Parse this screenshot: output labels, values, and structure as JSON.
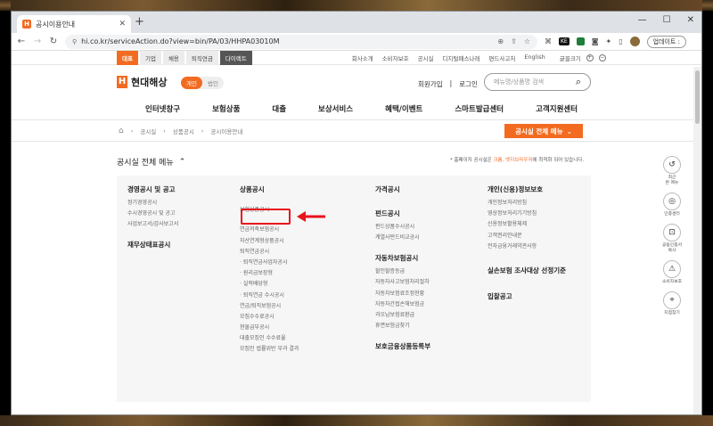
{
  "browser": {
    "tab_title": "공시이용안내",
    "tab_favicon": "H",
    "new_tab": "+",
    "url": "hi.co.kr/serviceAction.do?view=bin/PA/03/HHPA03010M",
    "update_button": "업데이트 :",
    "window_controls": [
      "—",
      "☐",
      "✕"
    ],
    "ext_badge": "KE"
  },
  "utility": {
    "tabs": [
      "대표",
      "기업",
      "채용",
      "퇴직연금",
      "다이렉트"
    ],
    "links": [
      "회사소개",
      "소비자보호",
      "공시실",
      "디지털패스나래",
      "편드사고처",
      "English"
    ],
    "font_label": "글꼴크기"
  },
  "header": {
    "logo_mark": "H",
    "logo_text": "현대해상",
    "seg_personal": "개인",
    "seg_corporate": "법인",
    "join": "회원가입",
    "login": "로그인",
    "search_placeholder": "메뉴명/상품명 검색"
  },
  "gnb": [
    "인터넷창구",
    "보험상품",
    "대출",
    "보상서비스",
    "혜택/이벤트",
    "스마트발급센터",
    "고객지원센터"
  ],
  "breadcrumb": [
    "공시실",
    "상품공시",
    "공시이용안내"
  ],
  "allmenu_button": "공시실 전체 메뉴",
  "content": {
    "section_title": "공시실 전체 메뉴",
    "note_prefix": "* 홈페이지 공시실은 ",
    "note_browsers": "크롬, 엣지브라우저",
    "note_suffix": "에 최적화 되어 있습니다."
  },
  "columns": [
    {
      "groups": [
        {
          "title": "경영공시 및 공고",
          "items": [
            "정기경영공시",
            "수시경영공시 및 공고",
            "사업보고서/감사보고서"
          ]
        },
        {
          "title": "재무상태표공시",
          "items": []
        }
      ]
    },
    {
      "groups": [
        {
          "title": "상품공시",
          "items": [
            "보험상품공시",
            "",
            "연금저축보험공시",
            "자산연계형상품공시",
            "퇴직연금공시",
            "· 퇴직연금사업자공시",
            "· 원리금보장형",
            "· 실적배당형",
            "· 퇴직연금 수시공시",
            "연금/퇴직보험공시",
            "모집수수료공시",
            "현물급부공시",
            "대출모집인 수수료율",
            "모집인 법률위반 부과 결과"
          ]
        }
      ]
    },
    {
      "groups": [
        {
          "title": "가격공시",
          "items": []
        },
        {
          "title": "펀드공시",
          "items": [
            "펀드상품수시공시",
            "계열사펀드비교공시"
          ]
        },
        {
          "title": "자동차보험공시",
          "items": [
            "할인할증등급",
            "자동차사고보험처리절차",
            "자동차보험료조정현황",
            "자동차간접손해보험금",
            "과오납보험료환급",
            "휴면보험금찾기"
          ]
        },
        {
          "title": "보호금융상품등록부",
          "items": []
        }
      ]
    },
    {
      "groups": [
        {
          "title": "개인(신용)정보보호",
          "items": [
            "개인정보처리방침",
            "영상정보처리기기방침",
            "신용정보활용체제",
            "고객권리안내문",
            "전자금융거래약관사항"
          ]
        },
        {
          "title": "실손보험 조사대상 선정기준",
          "items": []
        },
        {
          "title": "입찰공고",
          "items": []
        }
      ]
    }
  ],
  "rail": [
    {
      "icon": "↺",
      "label": "최근\n본 메뉴"
    },
    {
      "icon": "◎",
      "label": "인증센터"
    },
    {
      "icon": "⊡",
      "label": "공동인증서\n복사"
    },
    {
      "icon": "⚠",
      "label": "소비자보호"
    },
    {
      "icon": "⌖",
      "label": "지점찾기"
    }
  ],
  "colors": {
    "brand_orange": "#f26b21",
    "highlight_red": "#e8131b"
  }
}
